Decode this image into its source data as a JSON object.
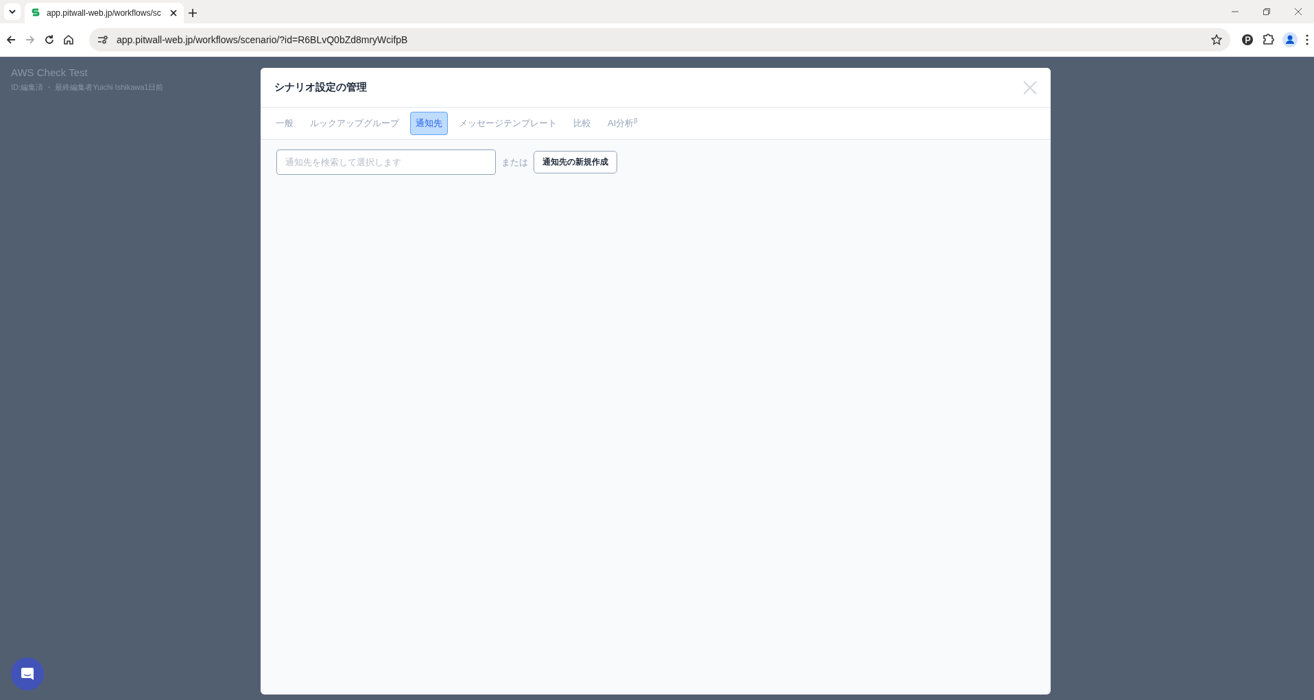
{
  "browser": {
    "tab_title": "app.pitwall-web.jp/workflows/sc",
    "url": "app.pitwall-web.jp/workflows/scenario/?id=R6BLvQ0bZd8mryWcifpB"
  },
  "background_page": {
    "title": "AWS Check Test",
    "subtitle": "ID:編集済 ・ 最終編集者Yuichi Ishikawa1日前"
  },
  "modal": {
    "title": "シナリオ設定の管理",
    "tabs": [
      {
        "label": "一般",
        "selected": false
      },
      {
        "label": "ルックアップグループ",
        "selected": false
      },
      {
        "label": "通知先",
        "selected": true
      },
      {
        "label": "メッセージテンプレート",
        "selected": false
      },
      {
        "label": "比較",
        "selected": false
      },
      {
        "label": "AI分析$^{β}$",
        "selected": false
      }
    ],
    "search": {
      "placeholder": "通知先を検索して選択します"
    },
    "or_text": "または",
    "create_button": "通知先の新規作成"
  }
}
